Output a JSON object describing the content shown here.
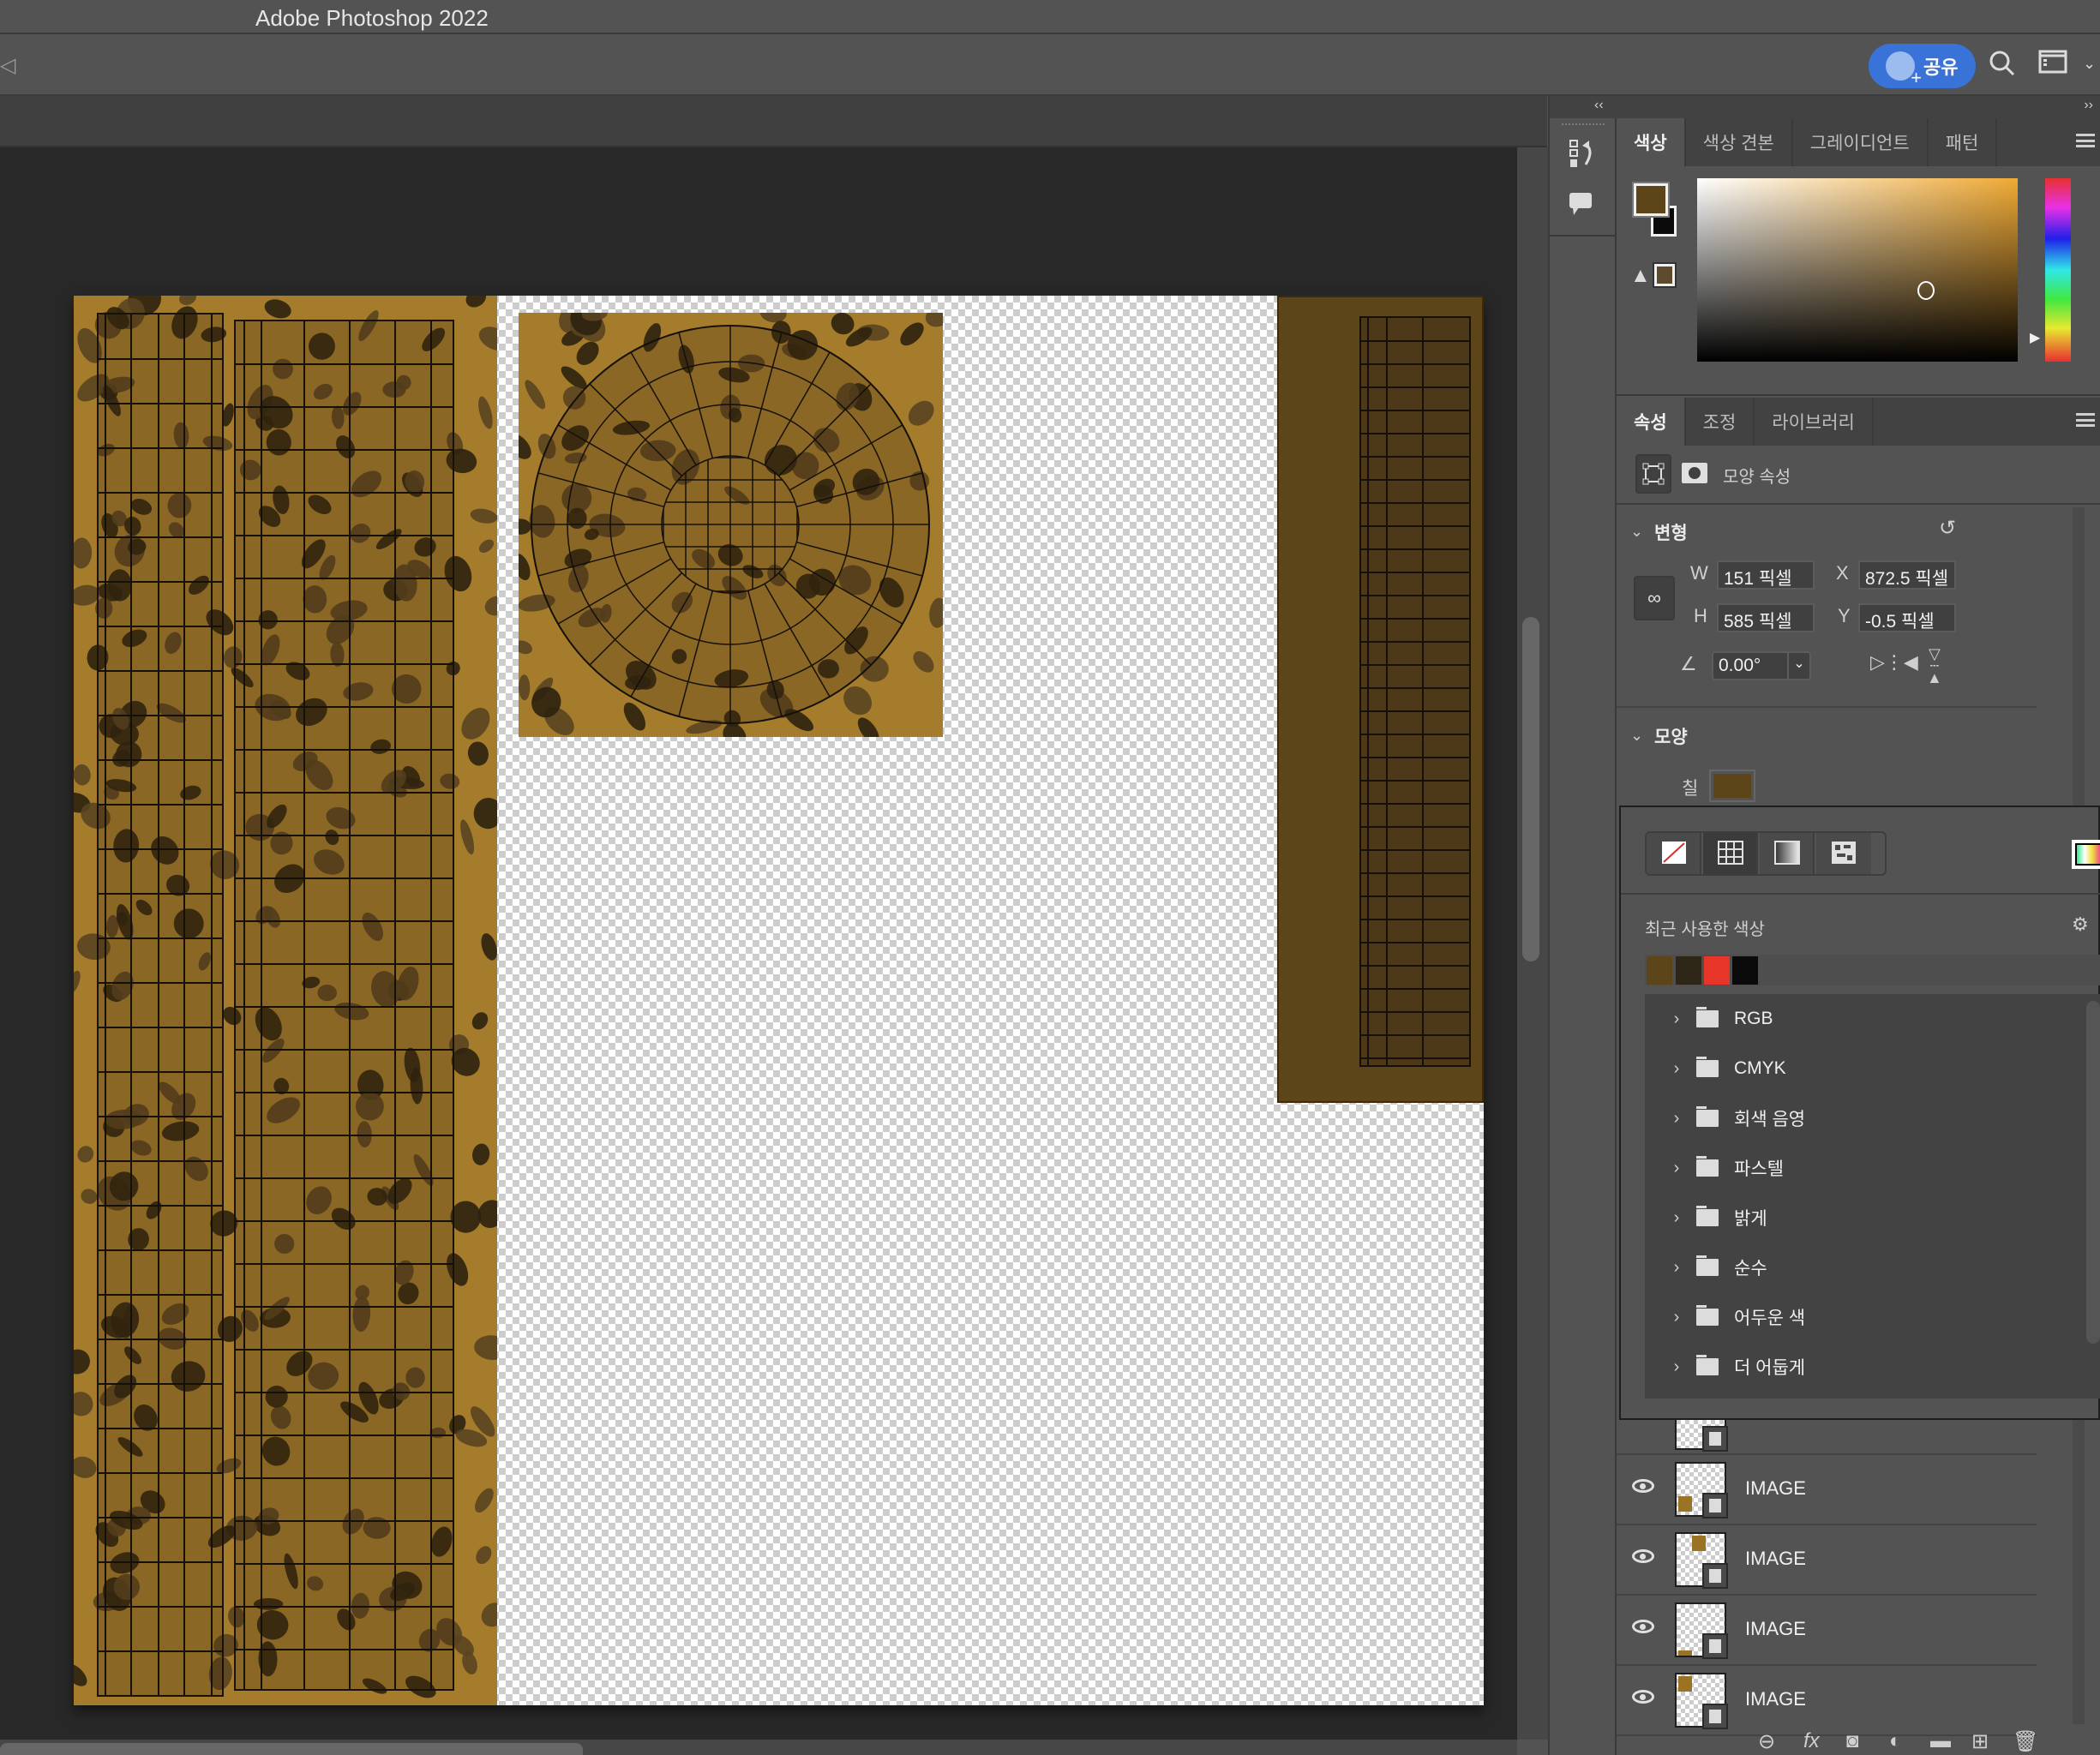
{
  "app": {
    "title": "Adobe Photoshop 2022"
  },
  "toolbar": {
    "share_label": "공유",
    "icons": [
      "panel-toggle-icon",
      "search-icon",
      "workspace-icon",
      "chevron-down-icon"
    ]
  },
  "canvas": {
    "pattern_color": "#a47c2c",
    "rect_color": "#5c4519",
    "layers_visible": [
      "grid-pattern-strip",
      "warped-circle-pattern",
      "brown-grid-rectangle"
    ]
  },
  "color_panel": {
    "tabs": [
      {
        "label": "색상",
        "active": true
      },
      {
        "label": "색상 견본",
        "active": false
      },
      {
        "label": "그레이디언트",
        "active": false
      },
      {
        "label": "패턴",
        "active": false
      }
    ],
    "foreground": "#5c4519",
    "background": "#0a0a0a",
    "gamut_swatch": "#5e4a2c"
  },
  "properties_panel": {
    "tabs": [
      {
        "label": "속성",
        "active": true
      },
      {
        "label": "조정",
        "active": false
      },
      {
        "label": "라이브러리",
        "active": false
      }
    ],
    "kind_label": "모양 속성",
    "transform": {
      "title": "변형",
      "w_label": "W",
      "w_value": "151 픽셀",
      "h_label": "H",
      "h_value": "585 픽셀",
      "x_label": "X",
      "x_value": "872.5 픽셀",
      "y_label": "Y",
      "y_value": "-0.5 픽셀",
      "angle_value": "0.00°"
    },
    "appearance": {
      "title": "모양",
      "fill_label": "칠",
      "fill_color": "#5c4519"
    }
  },
  "fill_popup": {
    "types": [
      "no-color",
      "solid-color",
      "gradient",
      "pattern"
    ],
    "active_type": "solid-color",
    "recent_label": "최근 사용한 색상",
    "recent_colors": [
      "#5c4519",
      "#2e2616",
      "#e8352a",
      "#0a0a0a"
    ],
    "folders": [
      "RGB",
      "CMYK",
      "회색 음영",
      "파스텔",
      "밝게",
      "순수",
      "어두운 색",
      "더 어둡게"
    ]
  },
  "layers_panel": {
    "layers": [
      {
        "name": "IMAGE",
        "visible": true
      },
      {
        "name": "IMAGE",
        "visible": true
      },
      {
        "name": "IMAGE",
        "visible": true
      },
      {
        "name": "IMAGE",
        "visible": true
      }
    ],
    "footer_icons": [
      "link-icon",
      "fx-icon",
      "mask-icon",
      "adjustment-icon",
      "group-folder-icon",
      "new-layer-icon",
      "trash-icon"
    ]
  }
}
